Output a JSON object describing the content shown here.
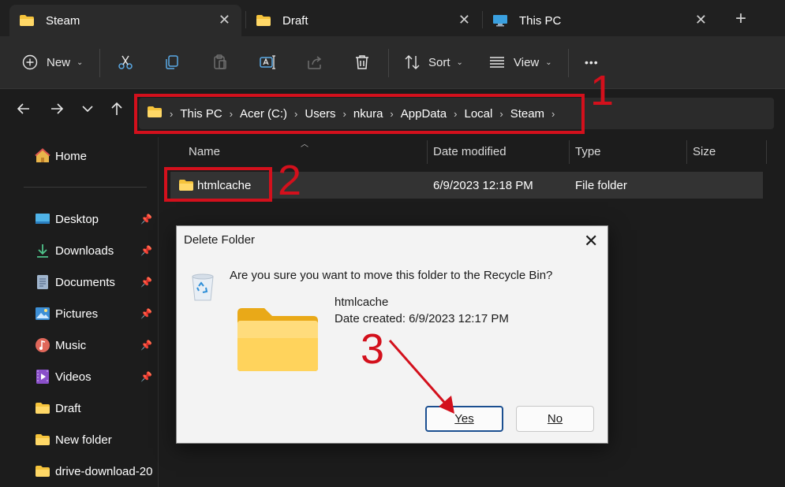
{
  "tabs": [
    {
      "label": "Steam",
      "icon": "folder-icon"
    },
    {
      "label": "Draft",
      "icon": "folder-icon"
    },
    {
      "label": "This PC",
      "icon": "monitor-icon"
    }
  ],
  "new_tab_symbol": "+",
  "toolbar": {
    "new_label": "New",
    "sort_label": "Sort",
    "view_label": "View",
    "more_symbol": "•••"
  },
  "breadcrumbs": [
    "This PC",
    "Acer (C:)",
    "Users",
    "nkura",
    "AppData",
    "Local",
    "Steam"
  ],
  "sidebar": {
    "home": "Home",
    "items": [
      {
        "label": "Desktop",
        "icon": "desktop-icon",
        "pinned": true
      },
      {
        "label": "Downloads",
        "icon": "download-icon",
        "pinned": true
      },
      {
        "label": "Documents",
        "icon": "document-icon",
        "pinned": true
      },
      {
        "label": "Pictures",
        "icon": "picture-icon",
        "pinned": true
      },
      {
        "label": "Music",
        "icon": "music-icon",
        "pinned": true
      },
      {
        "label": "Videos",
        "icon": "video-icon",
        "pinned": true
      },
      {
        "label": "Draft",
        "icon": "folder-icon",
        "pinned": false
      },
      {
        "label": "New folder",
        "icon": "folder-icon",
        "pinned": false
      },
      {
        "label": "drive-download-20",
        "icon": "folder-icon",
        "pinned": false
      }
    ]
  },
  "columns": {
    "name": "Name",
    "date_modified": "Date modified",
    "type": "Type",
    "size": "Size"
  },
  "files": [
    {
      "name": "htmlcache",
      "date_modified": "6/9/2023 12:18 PM",
      "type": "File folder",
      "size": ""
    }
  ],
  "dialog": {
    "title": "Delete Folder",
    "message": "Are you sure you want to move this folder to the Recycle Bin?",
    "item_name": "htmlcache",
    "date_created_label": "Date created:",
    "date_created_value": "6/9/2023 12:17 PM",
    "yes_label": "Yes",
    "no_label": "No"
  },
  "annotations": {
    "step1": "1",
    "step2": "2",
    "step3": "3",
    "color": "#d3101c"
  },
  "colors": {
    "background": "#1c1c1c",
    "toolbar": "#2b2b2b",
    "folder": "#f5c33b",
    "dialog": "#f3f3f3",
    "accent_border": "#1b4f90"
  }
}
